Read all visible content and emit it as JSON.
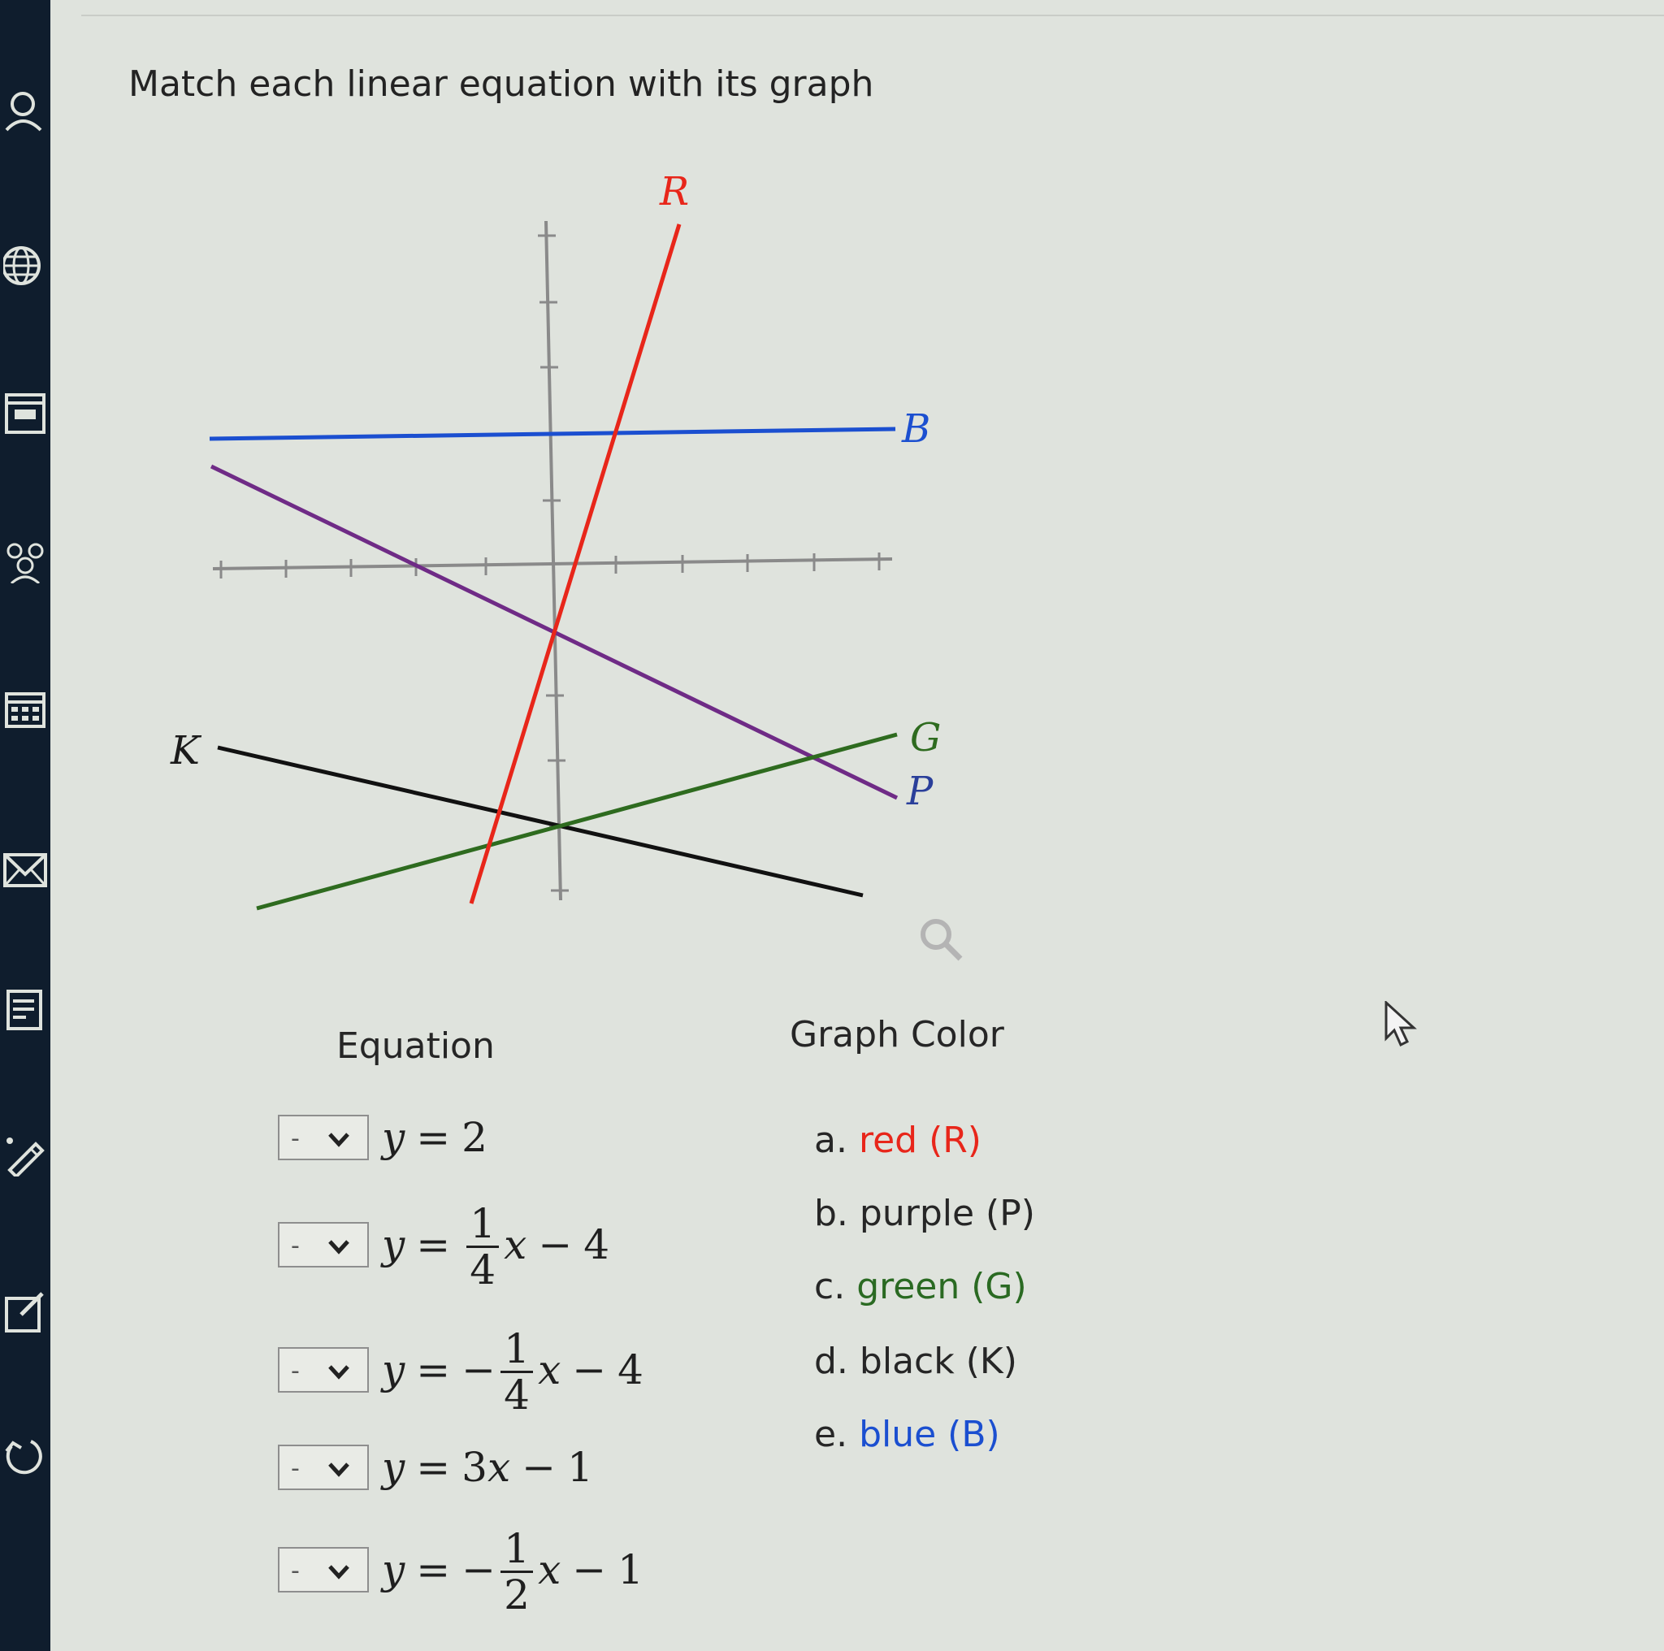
{
  "sidebar": {
    "icons": [
      "person-icon",
      "globe-icon",
      "browser-window-icon",
      "group-icon",
      "calendar-icon",
      "mail-icon",
      "notes-icon",
      "pencil-icon",
      "edit-icon",
      "logout-icon"
    ]
  },
  "question": {
    "prompt": "Match each linear equation with its graph"
  },
  "graph": {
    "line_labels": {
      "R": "R",
      "B": "B",
      "G": "G",
      "P": "P",
      "K": "K"
    },
    "colors": {
      "R": "#e8261a",
      "B": "#1b4fd0",
      "G": "#2e6b1f",
      "P": "#6f2b86",
      "K": "#111111",
      "axis": "#8a8a8a"
    }
  },
  "headings": {
    "equation": "Equation",
    "graph_color": "Graph Color"
  },
  "equations": [
    {
      "select_value": "-",
      "lhs": "y",
      "eq": "=",
      "rhs": "2"
    },
    {
      "select_value": "-",
      "lhs": "y",
      "eq": "=",
      "sign": "",
      "num": "1",
      "den": "4",
      "var": "x",
      "op": "−",
      "const": "4"
    },
    {
      "select_value": "-",
      "lhs": "y",
      "eq": "=",
      "sign": "−",
      "num": "1",
      "den": "4",
      "var": "x",
      "op": "−",
      "const": "4"
    },
    {
      "select_value": "-",
      "lhs": "y",
      "eq": "=",
      "coef": "3",
      "var": "x",
      "op": "−",
      "const": "1"
    },
    {
      "select_value": "-",
      "lhs": "y",
      "eq": "=",
      "sign": "−",
      "num": "1",
      "den": "2",
      "var": "x",
      "op": "−",
      "const": "1"
    }
  ],
  "choices": [
    {
      "letter": "a.",
      "label": "red (R)",
      "color": "#e8261a"
    },
    {
      "letter": "b.",
      "label": "purple (P)",
      "color": "#262626"
    },
    {
      "letter": "c.",
      "label": "green (G)",
      "color": "#2a6a22"
    },
    {
      "letter": "d.",
      "label": "black (K)",
      "color": "#262626"
    },
    {
      "letter": "e.",
      "label": "blue (B)",
      "color": "#1b4fd0"
    }
  ]
}
